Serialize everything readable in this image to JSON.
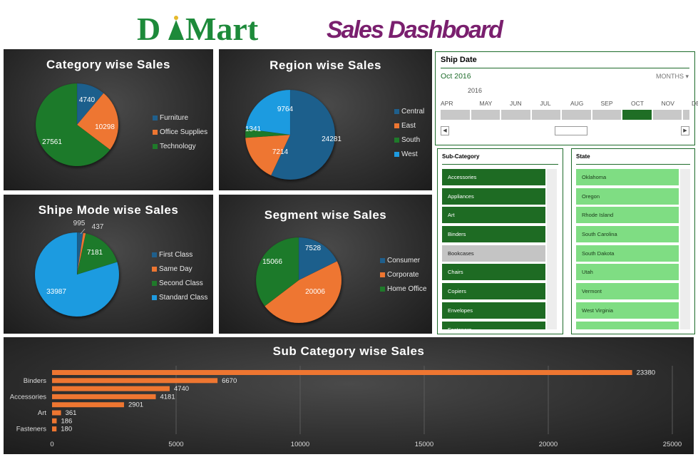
{
  "header": {
    "logo_text": "D Mart",
    "title": "Sales Dashboard"
  },
  "colors": {
    "blue": "#1f5f8c",
    "orange": "#ee7631",
    "green": "#1f7a2a",
    "light_blue": "#1e9be0",
    "slicer_green": "#1e6b23",
    "state_green": "#7fdd83",
    "bar_orange": "#ee7631"
  },
  "timeline": {
    "title": "Ship Date",
    "range": "Oct 2016",
    "level": "MONTHS",
    "year": "2016",
    "months": [
      "APR",
      "MAY",
      "JUN",
      "JUL",
      "AUG",
      "SEP",
      "OCT",
      "NOV",
      "DE"
    ],
    "selected_month": "OCT"
  },
  "subcategory_slicer": {
    "title": "Sub-Category",
    "items": [
      {
        "label": "Accessories",
        "selected": true
      },
      {
        "label": "Appliances",
        "selected": true
      },
      {
        "label": "Art",
        "selected": true
      },
      {
        "label": "Binders",
        "selected": true
      },
      {
        "label": "Bookcases",
        "selected": false
      },
      {
        "label": "Chairs",
        "selected": true
      },
      {
        "label": "Copiers",
        "selected": true
      },
      {
        "label": "Envelopes",
        "selected": true
      },
      {
        "label": "Fasteners",
        "selected": true
      }
    ]
  },
  "state_slicer": {
    "title": "State",
    "items": [
      "Oklahoma",
      "Oregon",
      "Rhode Island",
      "South Carolina",
      "South Dakota",
      "Utah",
      "Vermont",
      "West Virginia",
      ""
    ]
  },
  "chart_data": [
    {
      "id": "category",
      "type": "pie",
      "title": "Category wise Sales",
      "slices": [
        {
          "name": "Furniture",
          "value": 4740,
          "color": "#1f5f8c"
        },
        {
          "name": "Office Supplies",
          "value": 10298,
          "color": "#ee7631"
        },
        {
          "name": "Technology",
          "value": 27561,
          "color": "#1f7a2a"
        }
      ],
      "legend_position": "right"
    },
    {
      "id": "region",
      "type": "pie",
      "title": "Region wise Sales",
      "slices": [
        {
          "name": "Central",
          "value": 24281,
          "color": "#1f5f8c"
        },
        {
          "name": "East",
          "value": 7214,
          "color": "#ee7631"
        },
        {
          "name": "South",
          "value": 1341,
          "color": "#1f7a2a"
        },
        {
          "name": "West",
          "value": 9764,
          "color": "#1e9be0"
        }
      ],
      "legend_position": "right"
    },
    {
      "id": "shipmode",
      "type": "pie",
      "title": "Shipe Mode wise Sales",
      "slices": [
        {
          "name": "First Class",
          "value": 995,
          "color": "#1f5f8c"
        },
        {
          "name": "Same Day",
          "value": 437,
          "color": "#ee7631"
        },
        {
          "name": "Second Class",
          "value": 7181,
          "color": "#1f7a2a"
        },
        {
          "name": "Standard Class",
          "value": 33987,
          "color": "#1e9be0"
        }
      ],
      "legend_position": "right"
    },
    {
      "id": "segment",
      "type": "pie",
      "title": "Segment wise Sales",
      "slices": [
        {
          "name": "Consumer",
          "value": 7528,
          "color": "#1f5f8c"
        },
        {
          "name": "Corporate",
          "value": 20006,
          "color": "#ee7631"
        },
        {
          "name": "Home Office",
          "value": 15066,
          "color": "#1f7a2a"
        }
      ],
      "legend_position": "right"
    },
    {
      "id": "subcategory",
      "type": "bar",
      "orientation": "horizontal",
      "title": "Sub Category wise Sales",
      "bars": [
        {
          "label": "",
          "value": 23380
        },
        {
          "label": "Binders",
          "value": 6670
        },
        {
          "label": "",
          "value": 4740
        },
        {
          "label": "Accessories",
          "value": 4181
        },
        {
          "label": "",
          "value": 2901
        },
        {
          "label": "Art",
          "value": 361
        },
        {
          "label": "",
          "value": 186
        },
        {
          "label": "Fasteners",
          "value": 180
        }
      ],
      "xlim": [
        0,
        25000
      ],
      "xticks": [
        0,
        5000,
        10000,
        15000,
        20000,
        25000
      ],
      "grid": true
    }
  ]
}
